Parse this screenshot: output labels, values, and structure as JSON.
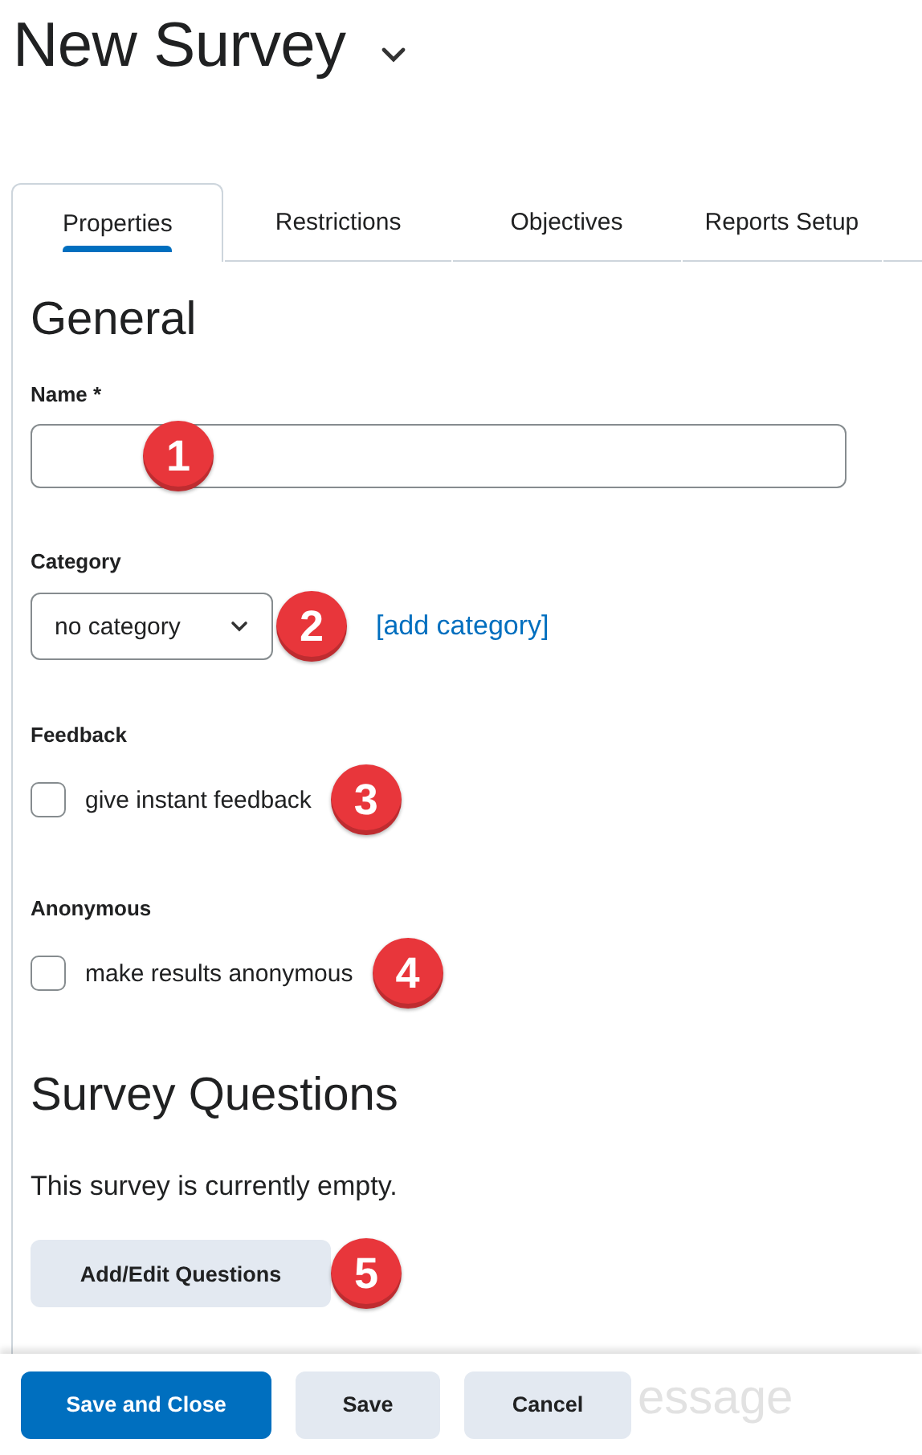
{
  "title": "New Survey",
  "tabs": [
    {
      "label": "Properties",
      "selected": true
    },
    {
      "label": "Restrictions",
      "selected": false
    },
    {
      "label": "Objectives",
      "selected": false
    },
    {
      "label": "Reports Setup",
      "selected": false
    }
  ],
  "general": {
    "heading": "General",
    "name_label": "Name *",
    "name_badge": "1",
    "category_label": "Category",
    "category_value": "no category",
    "category_badge": "2",
    "add_category_link": "[add category]",
    "options": [
      {
        "label": "Feedback",
        "checkbox": "give instant feedback",
        "checked": false,
        "badge": "3"
      },
      {
        "label": "Anonymous",
        "checkbox": "make results anonymous",
        "checked": false,
        "badge": "4"
      }
    ]
  },
  "questions": {
    "heading": "Survey Questions",
    "empty_text": "This survey is currently empty.",
    "button": "Add/Edit Questions",
    "badge": "5"
  },
  "footer": {
    "buttons": [
      {
        "label": "Save and Close",
        "kind": "primary"
      },
      {
        "label": "Save",
        "kind": "secondary"
      },
      {
        "label": "Cancel",
        "kind": "secondary"
      }
    ],
    "faded_fragments": [
      "essage"
    ]
  }
}
